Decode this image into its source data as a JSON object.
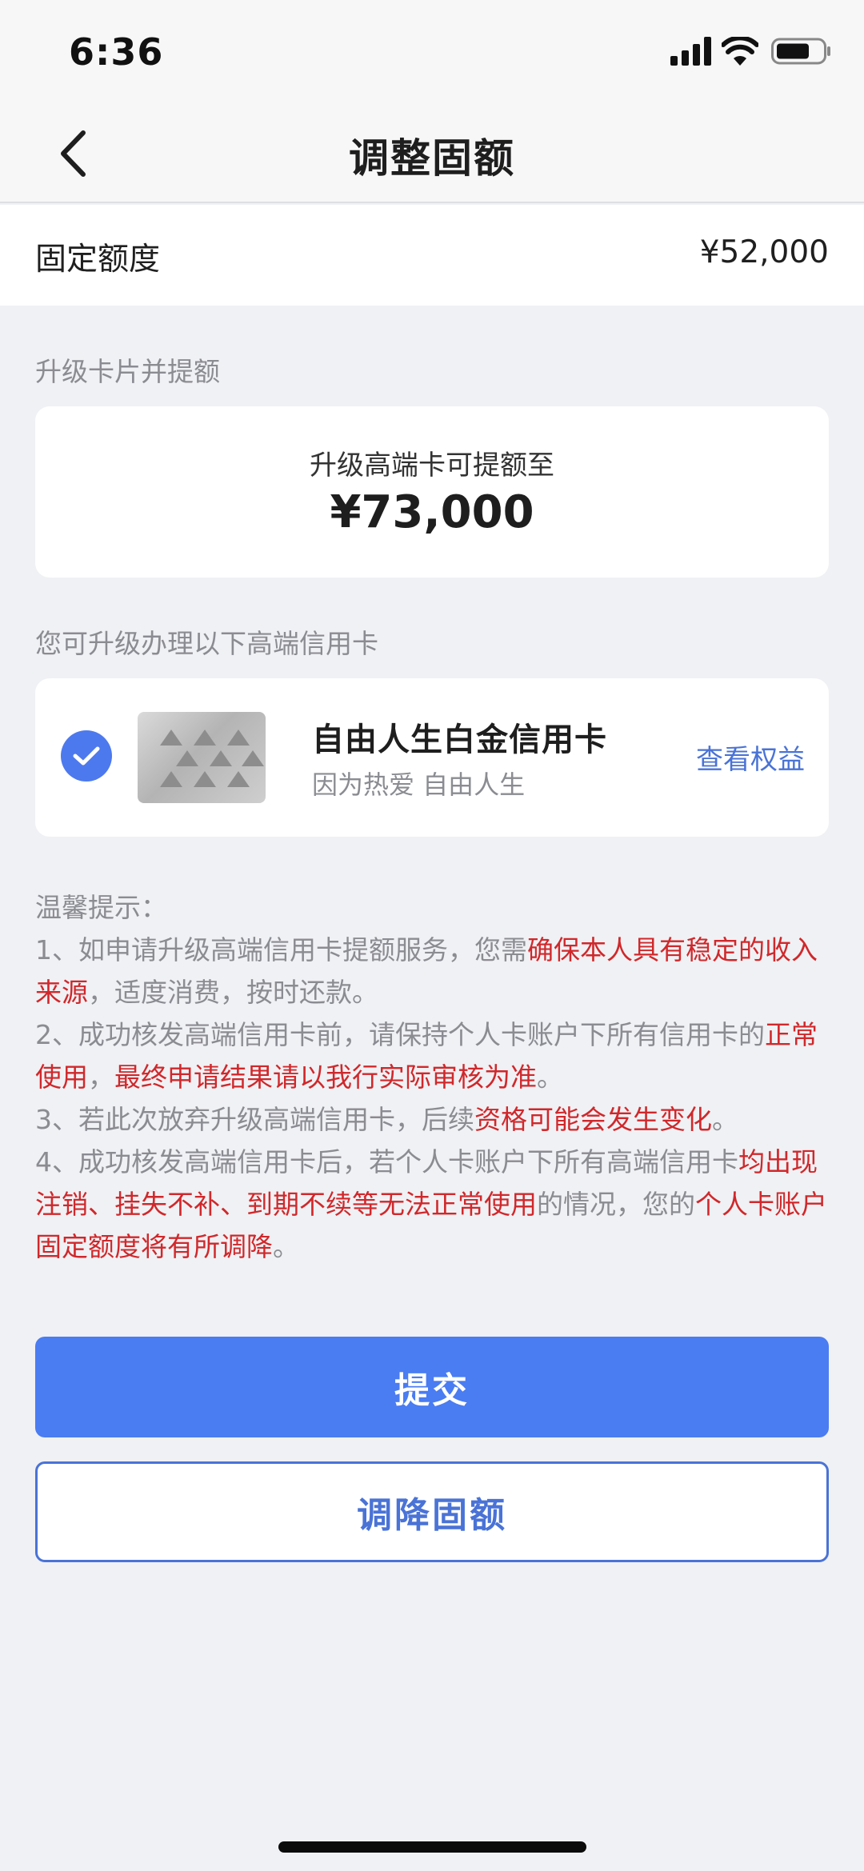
{
  "status_bar": {
    "time": "6:36"
  },
  "nav": {
    "title": "调整固额"
  },
  "fixed_limit": {
    "label": "固定额度",
    "value": "¥52,000"
  },
  "upgrade_section": {
    "label": "升级卡片并提额",
    "caption": "升级高端卡可提额至",
    "amount": "¥73,000"
  },
  "card_section": {
    "label": "您可升级办理以下高端信用卡",
    "card_name": "自由人生白金信用卡",
    "card_slogan": "因为热爱 自由人生",
    "view_benefits": "查看权益"
  },
  "tips": {
    "title": "温馨提示：",
    "item1_a": "1、如申请升级高端信用卡提额服务，您需",
    "item1_b": "确保本人具有稳定的收入来源",
    "item1_c": "，适度消费，按时还款。",
    "item2_a": "2、成功核发高端信用卡前，请保持个人卡账户下所有信用卡的",
    "item2_b": "正常使用",
    "item2_c": "，",
    "item2_d": "最终申请结果请以我行实际审核为准",
    "item2_e": "。",
    "item3_a": "3、若此次放弃升级高端信用卡，后续",
    "item3_b": "资格可能会发生变化",
    "item3_c": "。",
    "item4_a": "4、成功核发高端信用卡后，若个人卡账户下所有高端信用卡",
    "item4_b": "均出现注销、挂失不补、到期不续等无法正常使用",
    "item4_c": "的情况，您的",
    "item4_d": "个人卡账户固定额度将有所调降",
    "item4_e": "。"
  },
  "buttons": {
    "submit": "提交",
    "decrease": "调降固额"
  },
  "colors": {
    "accent": "#4a7cf2",
    "link": "#4a73d6",
    "warning": "#d0282b",
    "background": "#f0f1f4"
  }
}
